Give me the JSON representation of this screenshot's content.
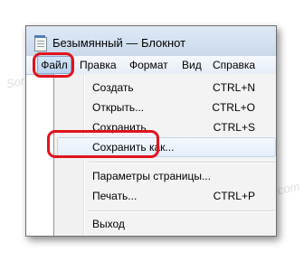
{
  "window": {
    "title": "Безымянный — Блокнот",
    "icon": "notepad-icon"
  },
  "menubar": {
    "items": [
      "Файл",
      "Правка",
      "Формат",
      "Вид",
      "Справка"
    ]
  },
  "file_menu": {
    "items": [
      {
        "label": "Создать",
        "shortcut": "CTRL+N"
      },
      {
        "label": "Открыть...",
        "shortcut": "CTRL+O"
      },
      {
        "label": "Сохранить",
        "shortcut": "CTRL+S"
      },
      {
        "label": "Сохранить как...",
        "shortcut": ""
      },
      {
        "label": "Параметры страницы...",
        "shortcut": ""
      },
      {
        "label": "Печать...",
        "shortcut": "CTRL+P"
      },
      {
        "label": "Выход",
        "shortcut": ""
      }
    ]
  },
  "annotation_color": "#e0141d",
  "watermark": "Soringpcrepair.com"
}
